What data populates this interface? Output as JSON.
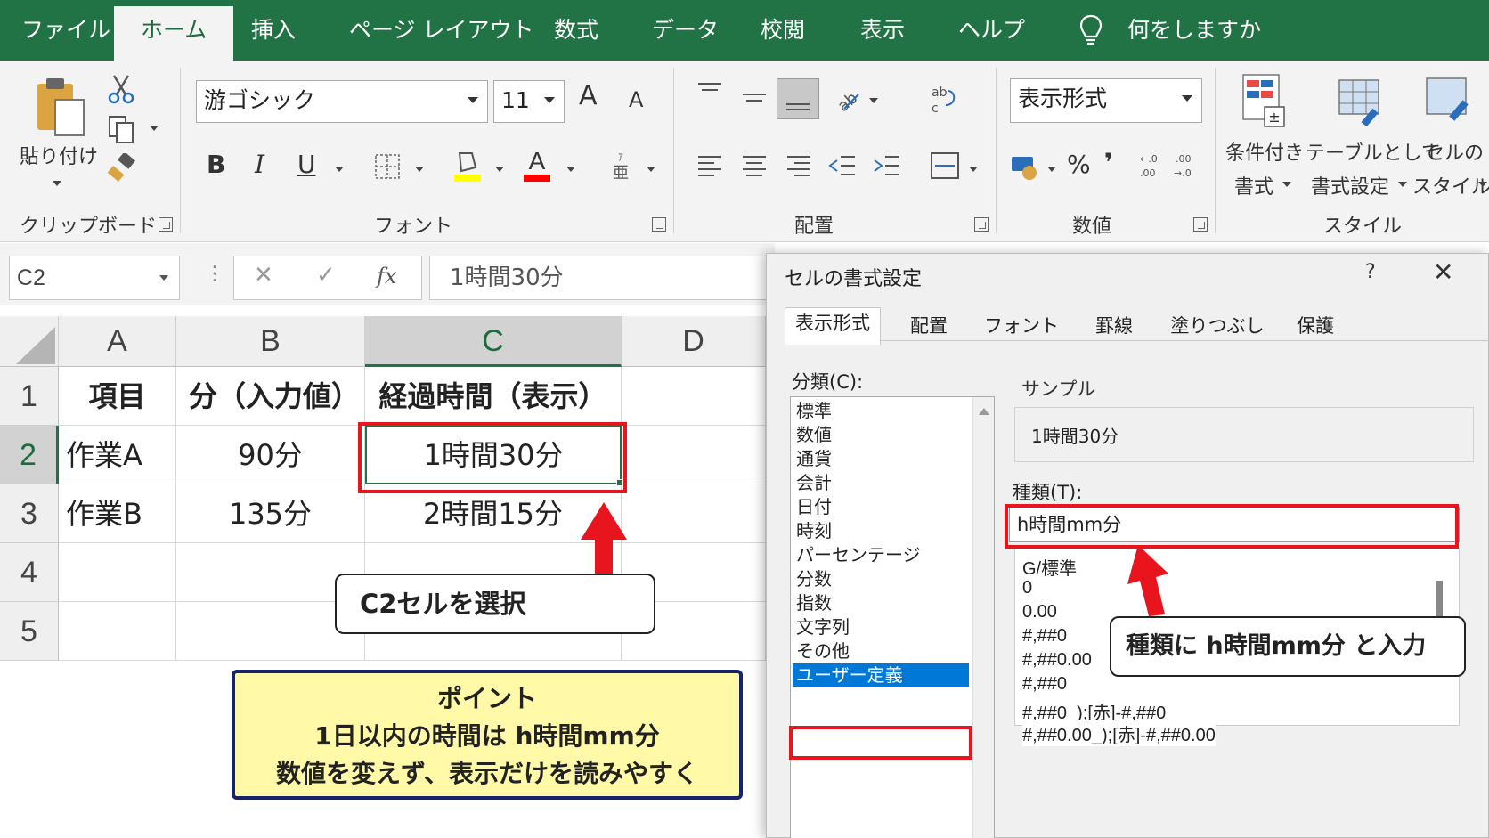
{
  "tabs": [
    "ファイル",
    "ホーム",
    "挿入",
    "ページ レイアウト",
    "数式",
    "データ",
    "校閲",
    "表示",
    "ヘルプ"
  ],
  "active_tab": "ホーム",
  "tell_me": "何をしますか",
  "ribbon": {
    "clipboard": {
      "paste": "貼り付け",
      "label": "クリップボード"
    },
    "font": {
      "name": "游ゴシック",
      "size": "11",
      "label": "フォント",
      "bold": "B",
      "italic": "I",
      "underline": "U",
      "grow": "A",
      "shrink": "A"
    },
    "alignment": {
      "label": "配置"
    },
    "number": {
      "format": "表示形式",
      "percent": "%",
      "comma": "❜",
      "label": "数値"
    },
    "styles": {
      "conditional_line1": "条件付き",
      "conditional_line2": "書式",
      "table_line1": "テーブルとして",
      "table_line2": "書式設定",
      "cell_line1": "セルの",
      "cell_line2": "スタイル",
      "label": "スタイル"
    },
    "colors": {
      "green": "#217346",
      "highlight": "#ffff00",
      "font_color": "#ff0000"
    }
  },
  "formula_bar": {
    "name_box": "C2",
    "cancel": "✕",
    "enter": "✓",
    "fx": "fx",
    "content": "1時間30分"
  },
  "sheet": {
    "columns": [
      "A",
      "B",
      "C",
      "D"
    ],
    "rows": [
      "1",
      "2",
      "3",
      "4",
      "5"
    ],
    "cells": [
      [
        "項目",
        "分（入力値）",
        "経過時間（表示）",
        ""
      ],
      [
        "作業A",
        "90分",
        "1時間30分",
        ""
      ],
      [
        "作業B",
        "135分",
        "2時間15分",
        ""
      ],
      [
        "",
        "",
        "",
        ""
      ],
      [
        "",
        "",
        "",
        ""
      ]
    ],
    "selected_cell": "C2"
  },
  "dialog": {
    "title": "セルの書式設定",
    "help": "?",
    "close": "✕",
    "tabs": [
      "表示形式",
      "配置",
      "フォント",
      "罫線",
      "塗りつぶし",
      "保護"
    ],
    "category_label": "分類(C):",
    "categories": [
      "標準",
      "数値",
      "通貨",
      "会計",
      "日付",
      "時刻",
      "パーセンテージ",
      "分数",
      "指数",
      "文字列",
      "その他",
      "ユーザー定義"
    ],
    "selected_category": "ユーザー定義",
    "sample_label": "サンプル",
    "sample_value": "1時間30分",
    "type_label": "種類(T):",
    "type_value": "h時間mm分",
    "type_list": [
      "G/標準",
      "0",
      "0.00",
      "#,##0",
      "#,##0.00",
      "#,##0",
      "#,##0_);[赤]-#,##0",
      "#,##0.00_);[赤]-#,##0.00"
    ]
  },
  "annotations": {
    "callout_select": "C2セルを選択",
    "callout_type": "種類に h時間mm分 と入力",
    "point_title": "ポイント",
    "point_line1": "1日以内の時間は h時間mm分",
    "point_line2": "数値を変えず、表示だけを読みやすく",
    "accent_red": "#e8141e",
    "point_bg": "#fff9a8",
    "point_border": "#16246b"
  }
}
